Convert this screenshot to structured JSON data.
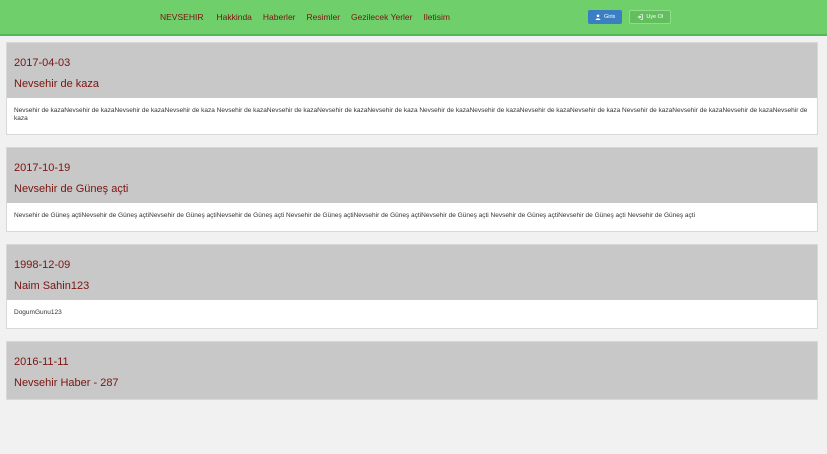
{
  "nav": {
    "brand": "NEVSEHIR",
    "links": [
      "Hakkinda",
      "Haberler",
      "Resimler",
      "Gezilecek Yerler",
      "Iletisim"
    ],
    "login_label": "Giris",
    "signup_label": "Uye Ol",
    "colors": {
      "bar": "#6fcf6b",
      "link": "#7a1410",
      "login": "#3b7ec2"
    }
  },
  "posts": [
    {
      "date": "2017-04-03",
      "title": "Nevsehir de kaza",
      "body": "Nevsehir de kazaNevsehir de kazaNevsehir de kazaNevsehir de kaza Nevsehir de kazaNevsehir de kazaNevsehir de kazaNevsehir de kaza Nevsehir de kazaNevsehir de kazaNevsehir de kazaNevsehir de kaza Nevsehir de kazaNevsehir de kazaNevsehir de kazaNevsehir de kaza"
    },
    {
      "date": "2017-10-19",
      "title": "Nevsehir de Güneş açti",
      "body": "Nevsehir de Güneş açtiNevsehir de Güneş açtiNevsehir de Güneş açtiNevsehir de Güneş açti Nevsehir de Güneş açtiNevsehir de Güneş açtiNevsehir de Güneş açti Nevsehir de Güneş açtiNevsehir de Güneş açti Nevsehir de Güneş açti"
    },
    {
      "date": "1998-12-09",
      "title": "Naim Sahin123",
      "body": "DogumGunu123"
    },
    {
      "date": "2016-11-11",
      "title": "Nevsehir Haber - 287"
    }
  ]
}
